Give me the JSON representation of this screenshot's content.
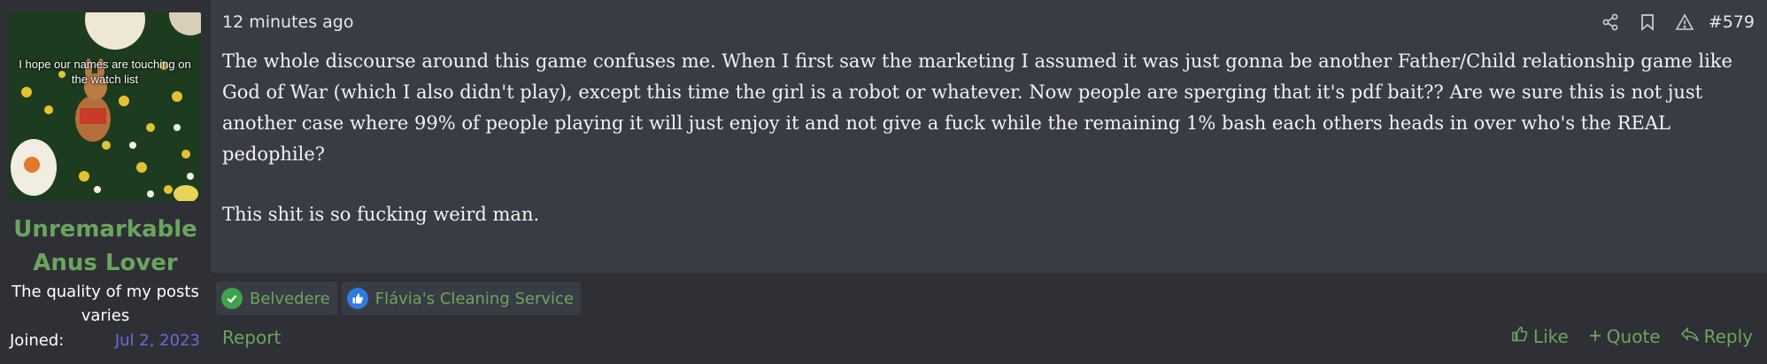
{
  "user": {
    "avatar_caption": "I hope our names are touching on the watch list",
    "name": "Unremarkable Anus Lover",
    "title": "The quality of my posts varies",
    "joined_label": "Joined:",
    "joined_value": "Jul 2, 2023"
  },
  "post": {
    "timestamp": "12 minutes ago",
    "number": "#579",
    "paragraphs": [
      "The whole discourse around this game confuses me. When I first saw the marketing I assumed it was just gonna be another Father/Child relationship game like God of War (which I also didn't play), except this time the girl is a robot or whatever. Now people are sperging that it's pdf bait?? Are we sure this is not just another case where 99% of people playing it will just enjoy it and not give a fuck while the remaining 1% bash each others heads in over who's the REAL pedophile?",
      "This shit is so fucking weird man."
    ]
  },
  "reactions": [
    {
      "label": "Belvedere",
      "icon": "check-icon",
      "color": "#3fa34d"
    },
    {
      "label": "Flávia's Cleaning Service",
      "icon": "thumbs-up-icon",
      "color": "#2e7be3"
    }
  ],
  "actions": {
    "report": "Report",
    "like": "Like",
    "quote": "Quote",
    "reply": "Reply"
  },
  "colors": {
    "accent_green": "#6aa55d",
    "date_link": "#6a6ad6",
    "post_bg": "#393c44",
    "page_bg": "#2e3036"
  }
}
